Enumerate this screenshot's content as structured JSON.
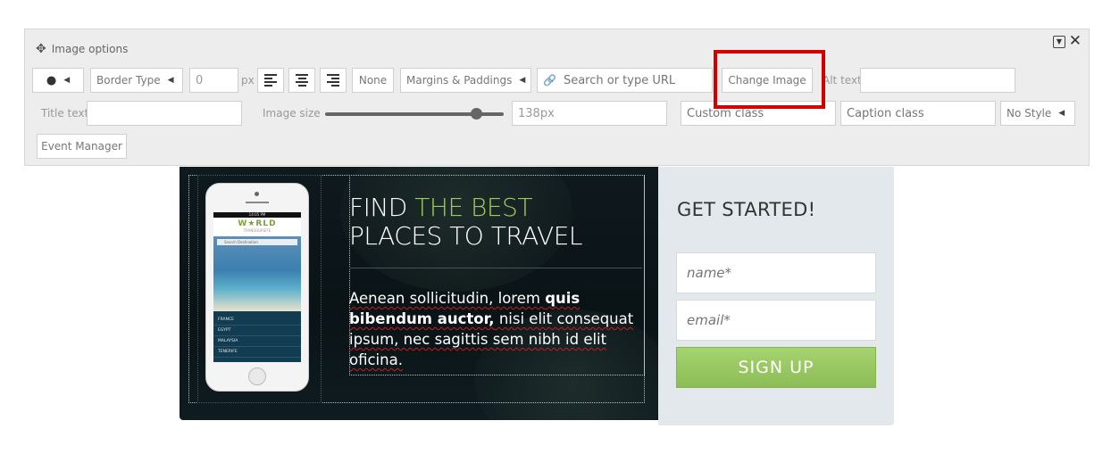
{
  "toolbar": {
    "title": "Image options",
    "border_type_label": "Border Type",
    "border_value": "0",
    "border_unit": "px",
    "none_label": "None",
    "margins_label": "Margins & Paddings",
    "url_placeholder": "Search or type URL",
    "change_image_label": "Change Image",
    "alt_text_label": "Alt text",
    "alt_text_value": "",
    "title_text_label": "Title text",
    "title_text_value": "",
    "image_size_label": "Image size",
    "image_size_value": "138px",
    "image_size_slider_fraction": 0.87,
    "custom_class_placeholder": "Custom class",
    "caption_class_placeholder": "Caption class",
    "style_label": "No Style",
    "event_manager_label": "Event Manager",
    "highlight_color": "#d40000"
  },
  "preview": {
    "phone": {
      "status_time": "14:05 PM",
      "logo": "W★RLD",
      "logo_sub": "TRANSOURSITE",
      "search_placeholder": "Search Destination",
      "list": [
        "FRANCE",
        "EGYPT",
        "MALAYSIA",
        "TENERIFE"
      ]
    },
    "headline_1": "FIND ",
    "headline_accent": "THE BEST",
    "headline_2": "PLACES TO TRAVEL",
    "desc_1": "Aenean sollicitudin, lorem ",
    "desc_bold": "quis bibendum auctor,",
    "desc_2": " nisi elit consequat ipsum, nec sagittis sem nibh id elit oficina.",
    "accent_color": "#9ccc5a"
  },
  "signup": {
    "title": "GET STARTED!",
    "name_placeholder": "name*",
    "email_placeholder": "email*",
    "button_label": "SIGN UP",
    "button_color": "#9acb62"
  }
}
